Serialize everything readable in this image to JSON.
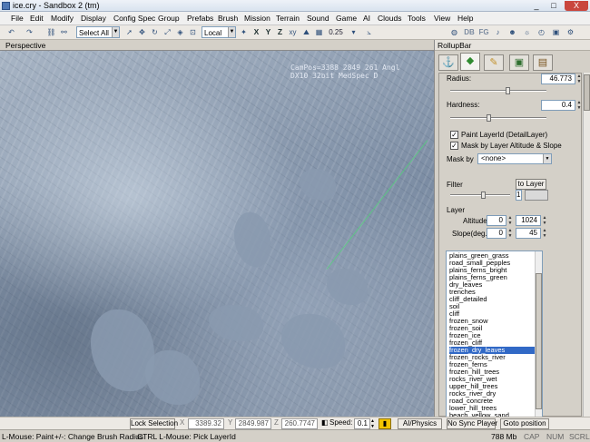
{
  "window": {
    "title": "ice.cry - Sandbox 2 (tm)",
    "controls": [
      "_",
      "□",
      "X"
    ]
  },
  "menu": [
    "File",
    "Edit",
    "Modify",
    "Display",
    "Config Spec",
    "Group",
    "Prefabs",
    "Brush",
    "Mission",
    "Terrain",
    "Sound",
    "Game",
    "AI",
    "Clouds",
    "Tools",
    "View",
    "Help"
  ],
  "toolbar": {
    "selection_filter": "Select All",
    "coord_system": "Local",
    "axes": [
      "X",
      "Y",
      "Z"
    ],
    "grid_size": "0.25",
    "right_labels": [
      "DB",
      "FG"
    ]
  },
  "viewport": {
    "label": "Perspective",
    "info_line1": "CamPos=3388 2849 261 Angl",
    "info_line2": "DX10 32bit MedSpec D"
  },
  "rollup": {
    "title": "RollupBar",
    "radius_label": "Radius:",
    "radius_value": "46.773",
    "radius_level": 0.6,
    "hardness_label": "Hardness:",
    "hardness_value": "0.4",
    "hardness_level": 0.4,
    "paint_layer_label": "Paint LayerId (DetailLayer)",
    "paint_layer_checked": true,
    "mask_altitude_label": "Mask by Layer Altitude & Slope",
    "mask_altitude_checked": true,
    "mask_by_label": "Mask by",
    "mask_by_value": "<none>",
    "filter_label": "Filter",
    "to_layer_button": "to Layer",
    "filter_level": 0.55,
    "filter_value": "1",
    "layer_label": "Layer",
    "altitude_label": "Altitude",
    "altitude_min": "0",
    "altitude_max": "1024",
    "slope_label": "Slope(deg.)",
    "slope_min": "0",
    "slope_max": "45",
    "layers": [
      "plains_green_grass",
      "road_small_pepples",
      "plains_ferns_bright",
      "plains_ferns_green",
      "dry_leaves",
      "trenches",
      "cliff_detailed",
      "soil",
      "cliff",
      "frozen_snow",
      "frozen_soil",
      "frozen_ice",
      "frozen_cliff",
      "frozen_dry_leaves",
      "frozen_rocks_river",
      "frozen_ferns",
      "frozen_hill_trees",
      "rocks_river_wet",
      "upper_hill_trees",
      "rocks_river_dry",
      "road_concrete",
      "lower_hill_trees",
      "beach_yellow_sand"
    ],
    "selected_layer": "frozen_dry_leaves"
  },
  "bottom": {
    "lock_selection": "Lock Selection",
    "x_label": "X",
    "x_value": "3389.32",
    "y_label": "Y",
    "y_value": "2849.987",
    "z_label": "Z",
    "z_value": "260.7747",
    "speed_label": "Speed:",
    "speed_value": "0.1",
    "ai_physics": "AI/Physics",
    "sync_player": "No Sync Player",
    "goto_position": "Goto position"
  },
  "status": {
    "hint1": "L-Mouse: Paint",
    "hint2": "+/-: Change Brush Radius",
    "hint3": "CTRL L-Mouse: Pick LayerId",
    "memory": "788 Mb",
    "indicators": [
      "CAP",
      "NUM",
      "SCRL"
    ]
  },
  "colors": {
    "selection_highlight": "#3169c6",
    "title_gradient_top": "#eef2f8"
  }
}
